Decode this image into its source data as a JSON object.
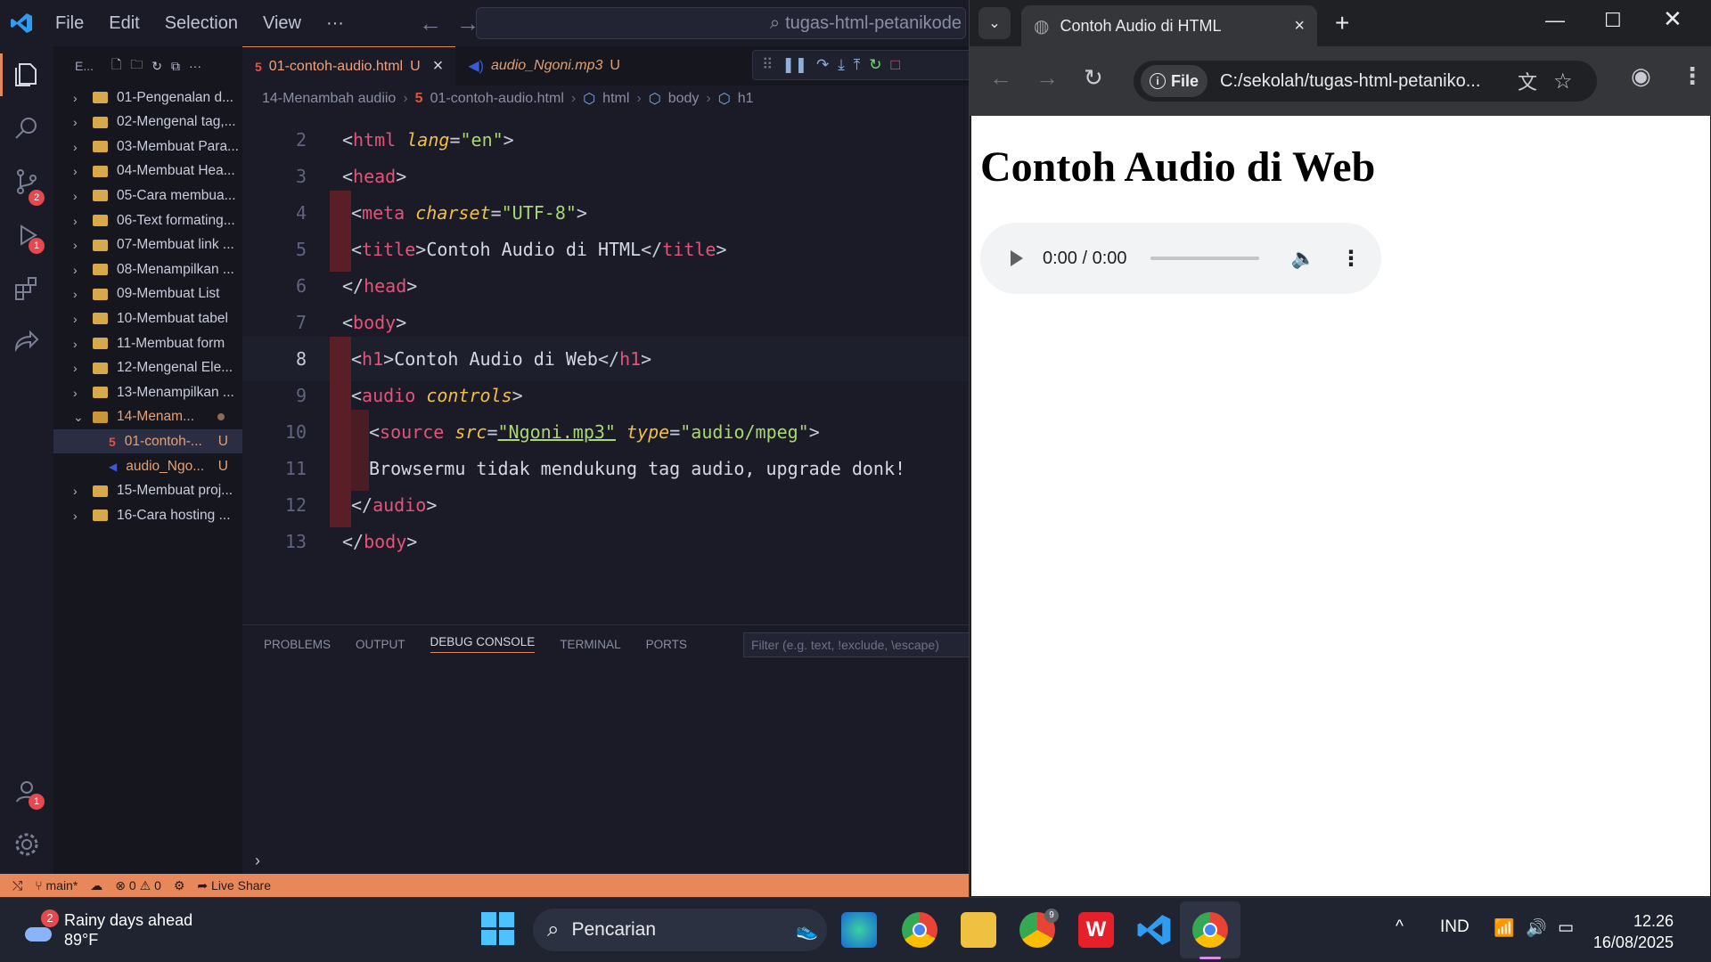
{
  "vscode": {
    "menu": [
      "File",
      "Edit",
      "Selection",
      "View",
      "···"
    ],
    "command_center": "tugas-html-petanikode",
    "explorer_title": "E...",
    "activity_badges": {
      "source_control": "2",
      "run_debug": "1",
      "accounts": "1"
    },
    "tree": [
      {
        "label": "01-Pengenalan d...",
        "type": "folder"
      },
      {
        "label": "02-Mengenal tag,...",
        "type": "folder"
      },
      {
        "label": "03-Membuat Para...",
        "type": "folder"
      },
      {
        "label": "04-Membuat Hea...",
        "type": "folder"
      },
      {
        "label": "05-Cara membua...",
        "type": "folder"
      },
      {
        "label": "06-Text formating...",
        "type": "folder"
      },
      {
        "label": "07-Membuat link ...",
        "type": "folder"
      },
      {
        "label": "08-Menampilkan ...",
        "type": "folder"
      },
      {
        "label": "09-Membuat List",
        "type": "folder"
      },
      {
        "label": "10-Membuat tabel",
        "type": "folder"
      },
      {
        "label": "11-Membuat form",
        "type": "folder"
      },
      {
        "label": "12-Mengenal Ele...",
        "type": "folder"
      },
      {
        "label": "13-Menampilkan ...",
        "type": "folder"
      },
      {
        "label": "14-Menam...",
        "type": "folder-open"
      },
      {
        "label": "01-contoh-...",
        "type": "html-file",
        "status": "U"
      },
      {
        "label": "audio_Ngo...",
        "type": "audio-file",
        "status": "U"
      },
      {
        "label": "15-Membuat proj...",
        "type": "folder"
      },
      {
        "label": "16-Cara hosting ...",
        "type": "folder"
      }
    ],
    "tabs": [
      {
        "label": "01-contoh-audio.html",
        "status": "U",
        "close": "×"
      },
      {
        "label": "audio_Ngoni.mp3",
        "status": "U"
      }
    ],
    "breadcrumbs": [
      "14-Menambah audiio",
      "01-contoh-audio.html",
      "html",
      "body",
      "h1"
    ],
    "code_lines": [
      "2",
      "3",
      "4",
      "5",
      "6",
      "7",
      "8",
      "9",
      "10",
      "11",
      "12",
      "13"
    ],
    "code": {
      "l2_tag": "html",
      "l2_attr": "lang",
      "l2_val": "\"en\"",
      "l3_tag": "head",
      "l4_tag": "meta",
      "l4_attr": "charset",
      "l4_val": "\"UTF-8\"",
      "l5_tag": "title",
      "l5_text": "Contoh Audio di HTML",
      "l6_tag": "head",
      "l7_tag": "body",
      "l8_tag": "h1",
      "l8_text": "Contoh Audio di Web",
      "l9_tag": "audio",
      "l9_attr": "controls",
      "l10_tag": "source",
      "l10_attr1": "src",
      "l10_val1": "\"Ngoni.mp3\"",
      "l10_attr2": "type",
      "l10_val2": "\"audio/mpeg\"",
      "l11_text": "Browsermu tidak mendukung tag audio, upgrade donk!",
      "l12_tag": "audio",
      "l13_tag": "body"
    },
    "panel_tabs": [
      "PROBLEMS",
      "OUTPUT",
      "DEBUG CONSOLE",
      "TERMINAL",
      "PORTS"
    ],
    "panel_filter_placeholder": "Filter (e.g. text, !exclude, \\escape)",
    "status": {
      "branch": "main*",
      "errors": "0",
      "warnings": "0",
      "live_share": "Live Share"
    }
  },
  "browser": {
    "tab_title": "Contoh Audio di HTML",
    "close": "×",
    "new_tab": "+",
    "chip": "File",
    "url": "C:/sekolah/tugas-html-petaniko...",
    "page_heading": "Contoh Audio di Web",
    "audio_time": "0:00 / 0:00"
  },
  "taskbar": {
    "weather_badge": "2",
    "weather_title": "Rainy days ahead",
    "weather_temp": "89°F",
    "search_placeholder": "Pencarian",
    "lang": "IND",
    "time": "12.26",
    "date": "16/08/2025",
    "chrome_badge": "9"
  },
  "colors": {
    "vscode_status": "#e8875a",
    "tag": "#e5527a",
    "attr": "#f0c040",
    "string": "#a8d86e"
  }
}
